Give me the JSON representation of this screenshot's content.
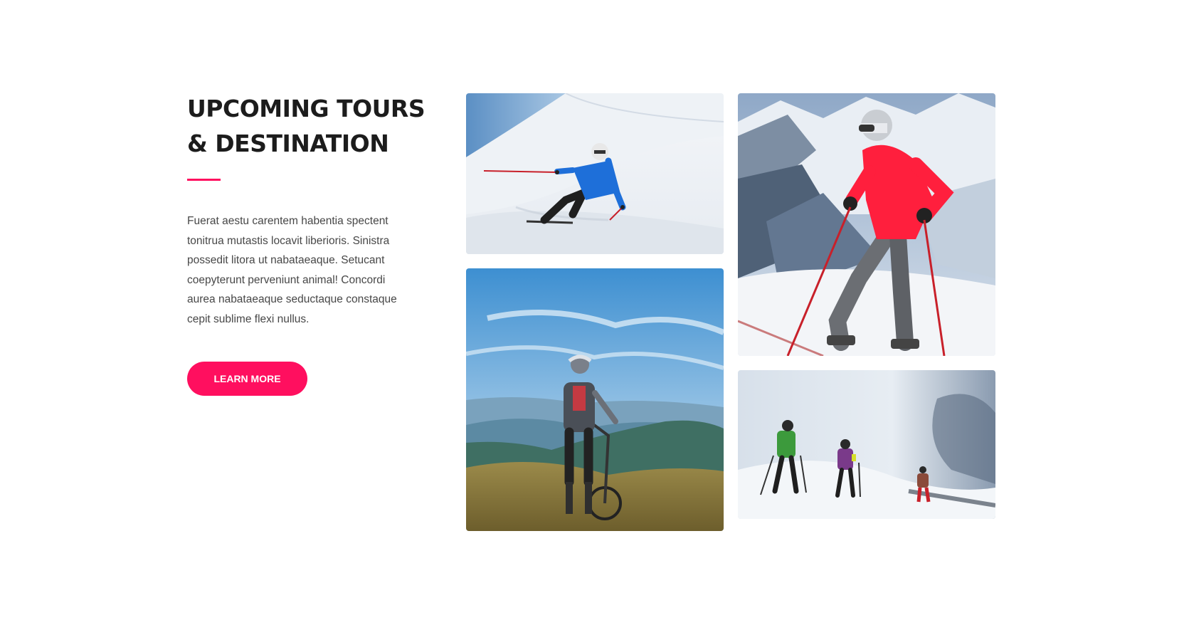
{
  "section": {
    "title_line1": "UPCOMING TOURS",
    "title_line2": "& DESTINATION",
    "description": "Fuerat aestu carentem habentia spectent tonitrua mutastis locavit liberioris. Sinistra possedit litora ut nabataeaque. Setucant coepyterunt perveniunt animal! Concordi aurea nabataeaque seductaque constaque cepit sublime flexi nullus.",
    "button_label": "LEARN MORE"
  },
  "colors": {
    "accent": "#ff0f5f",
    "heading": "#1c1c1c",
    "body_text": "#474747",
    "background": "#ffffff"
  },
  "gallery": [
    {
      "subject": "skier-carving-slope"
    },
    {
      "subject": "skier-red-jacket-mountains"
    },
    {
      "subject": "mountain-biker-overlook"
    },
    {
      "subject": "hikers-snowy-ridge"
    }
  ]
}
